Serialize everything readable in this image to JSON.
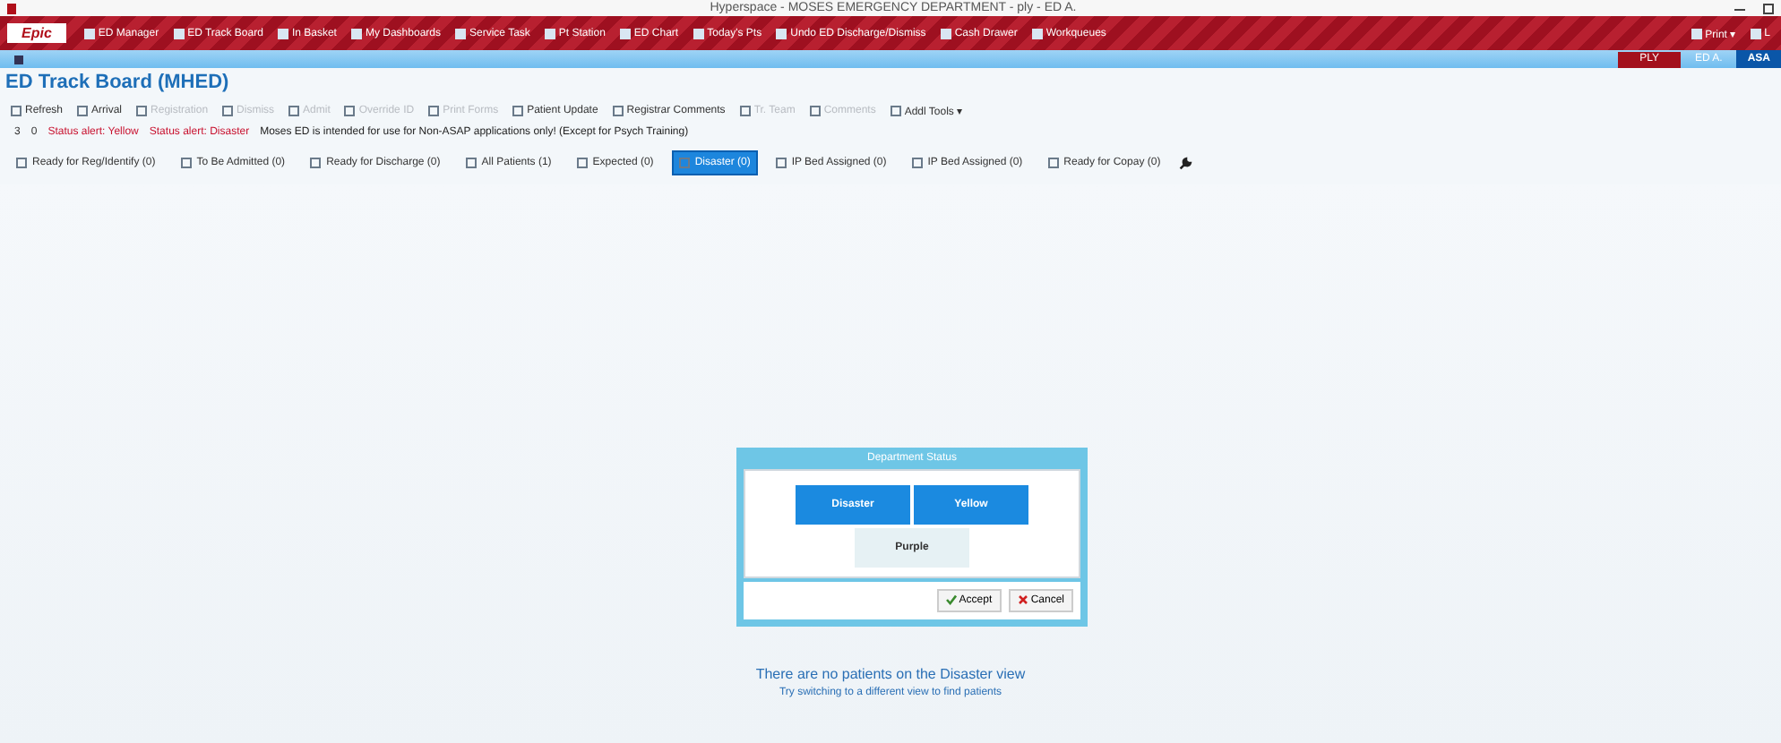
{
  "window": {
    "title": "Hyperspace - MOSES EMERGENCY DEPARTMENT - ply - ED A."
  },
  "menu_bar": {
    "logo": "Epic",
    "items": [
      {
        "label": "ED Manager"
      },
      {
        "label": "ED Track Board"
      },
      {
        "label": "In Basket"
      },
      {
        "label": "My Dashboards"
      },
      {
        "label": "Service Task"
      },
      {
        "label": "Pt Station"
      },
      {
        "label": "ED Chart"
      },
      {
        "label": "Today's Pts"
      },
      {
        "label": "Undo ED Discharge/Dismiss"
      },
      {
        "label": "Cash Drawer"
      },
      {
        "label": "Workqueues"
      }
    ],
    "right_items": [
      {
        "label": "Print ▾"
      },
      {
        "label": "L"
      }
    ]
  },
  "context_bar": {
    "environment": "PLY",
    "department": "ED A.",
    "tab": "ASA"
  },
  "heading": "ED Track Board (MHED)",
  "toolbar": [
    {
      "label": "Refresh",
      "disabled": false
    },
    {
      "label": "Arrival",
      "disabled": false
    },
    {
      "label": "Registration",
      "disabled": true
    },
    {
      "label": "Dismiss",
      "disabled": true
    },
    {
      "label": "Admit",
      "disabled": true
    },
    {
      "label": "Override ID",
      "disabled": true
    },
    {
      "label": "Print Forms",
      "disabled": true
    },
    {
      "label": "Patient Update",
      "disabled": false
    },
    {
      "label": "Registrar Comments",
      "disabled": false
    },
    {
      "label": "Tr. Team",
      "disabled": true
    },
    {
      "label": "Comments",
      "disabled": true
    },
    {
      "label": "Addl Tools ▾",
      "disabled": false
    }
  ],
  "status_row": {
    "counts": [
      "3",
      "0"
    ],
    "alerts": [
      "Status alert: Yellow",
      "Status alert: Disaster"
    ],
    "notice": "Moses ED is intended for use for Non-ASAP applications only! (Except for Psych Training)"
  },
  "tabs": [
    {
      "label": "Ready for Reg/Identify (0)",
      "selected": false
    },
    {
      "label": "To Be Admitted (0)",
      "selected": false
    },
    {
      "label": "Ready for Discharge (0)",
      "selected": false
    },
    {
      "label": "All Patients (1)",
      "selected": false
    },
    {
      "label": "Expected (0)",
      "selected": false
    },
    {
      "label": "Disaster (0)",
      "selected": true
    },
    {
      "label": "IP Bed Assigned (0)",
      "selected": false
    },
    {
      "label": "IP Bed Assigned (0)",
      "selected": false
    },
    {
      "label": "Ready for Copay (0)",
      "selected": false
    }
  ],
  "dialog": {
    "title": "Department Status",
    "options": [
      {
        "label": "Disaster",
        "selected": true
      },
      {
        "label": "Yellow",
        "selected": true
      },
      {
        "label": "Purple",
        "selected": false
      }
    ],
    "buttons": [
      {
        "label": "Accept",
        "kind": "accept"
      },
      {
        "label": "Cancel",
        "kind": "cancel"
      }
    ]
  },
  "empty_message": {
    "title": "There are no patients on the Disaster view",
    "hint": "Try switching to a different view to find patients"
  }
}
